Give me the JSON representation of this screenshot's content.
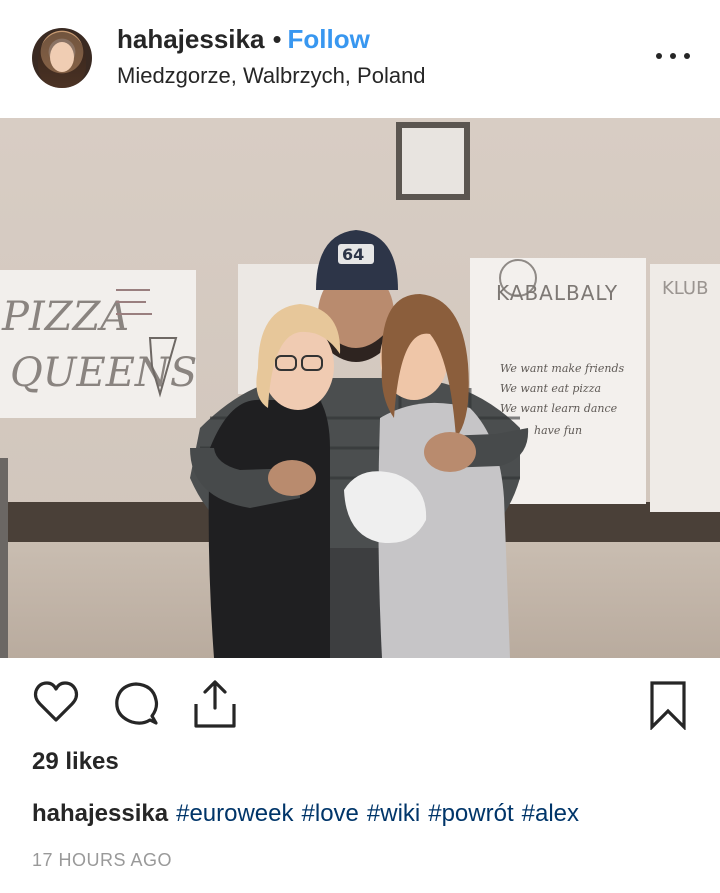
{
  "post": {
    "username": "hahajessika",
    "separator": "•",
    "follow_label": "Follow",
    "location": "Miedzgorze, Walbrzych, Poland",
    "more_icon": "more-horizontal-icon",
    "photo_alt": ""
  },
  "photo_text": {
    "left_poster": [
      "PIZZA",
      "QUEENS"
    ],
    "right_poster_title": "KABALBALY",
    "right_poster_lines": [
      "We want make friends",
      "We want eat pizza",
      "We want learn dance",
      "have fun"
    ],
    "edge_poster": "KLUB"
  },
  "actions": {
    "like_icon": "heart-icon",
    "comment_icon": "comment-icon",
    "share_icon": "share-icon",
    "save_icon": "bookmark-icon"
  },
  "likes": "29 likes",
  "caption": {
    "username": "hahajessika",
    "hashtags": [
      "#euroweek",
      "#love",
      "#wiki",
      "#powrót",
      "#alex"
    ]
  },
  "time": "17 HOURS AGO",
  "colors": {
    "link_blue": "#3897f0",
    "hashtag": "#003569",
    "text": "#262626",
    "muted": "#999999"
  }
}
